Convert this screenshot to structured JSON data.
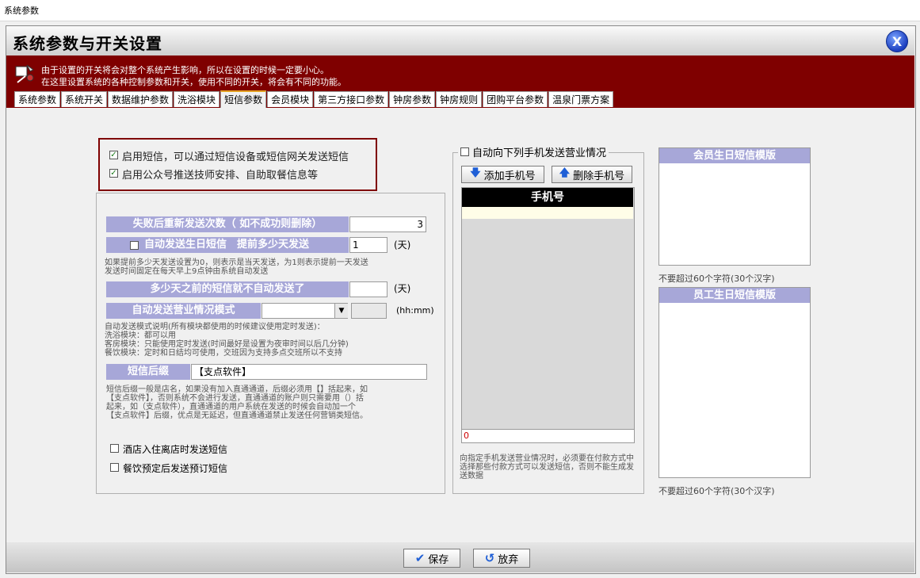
{
  "window": {
    "title": "系统参数"
  },
  "header": {
    "title": "系统参数与开关设置",
    "close_label": "X"
  },
  "banner": {
    "line1": "由于设置的开关将会对整个系统产生影响，所以在设置的时候一定要小心。",
    "line2": "在这里设置系统的各种控制参数和开关，使用不同的开关，将会有不同的功能。"
  },
  "tabs": [
    {
      "label": "系统参数"
    },
    {
      "label": "系统开关"
    },
    {
      "label": "数据维护参数"
    },
    {
      "label": "洗浴模块"
    },
    {
      "label": "短信参数"
    },
    {
      "label": "会员模块"
    },
    {
      "label": "第三方接口参数"
    },
    {
      "label": "钟房参数"
    },
    {
      "label": "钟房规则"
    },
    {
      "label": "团购平台参数"
    },
    {
      "label": "温泉门票方案"
    }
  ],
  "sms": {
    "enable_sms": {
      "label": "启用短信，可以通过短信设备或短信网关发送短信",
      "checked": true
    },
    "enable_wechat": {
      "label": "启用公众号推送技师安排、自助取餐信息等",
      "checked": true
    },
    "retry_label": "失败后重新发送次数（ 如不成功则删除）",
    "retry_value": "3",
    "birthday_label": "自动发送生日短信　提前多少天发送",
    "birthday_checked": false,
    "birthday_value": "1",
    "day_unit": "(天)",
    "birthday_note": "如果提前多少天发送设置为0，则表示是当天发送，为1则表示提前一天发送\n发送时间固定在每天早上9点钟由系统自动发送",
    "skip_label": "多少天之前的短信就不自动发送了",
    "skip_value": "",
    "mode_label": "自动发送营业情况模式",
    "mode_value": "",
    "time_value": "",
    "time_unit": "(hh:mm)",
    "mode_note": "自动发送模式说明(所有模块都使用的时候建议使用定时发送)：\n洗浴模块：都可以用\n客房模块：只能使用定时发送(时间最好是设置为夜审时间以后几分钟)\n餐饮模块：定时和日结均可使用，交班因为支持多点交班所以不支持",
    "suffix_label": "短信后缀",
    "suffix_value": "【支点软件】",
    "suffix_note": "短信后缀一般是店名，如果没有加入直通通道，后缀必须用【】括起来，如\n【支点软件】，否则系统不会进行发送，直通通道的账户则只需要用（）括\n起来，如（支点软件），直通通道的用户系统在发送的时候会自动加一个\n【支点软件】后缀，优点是无延迟，但直通通道禁止发送任何营销类短信。",
    "hotel_label": "酒店入住离店时发送短信",
    "hotel_checked": false,
    "dining_label": "餐饮预定后发送预订短信",
    "dining_checked": false
  },
  "phones": {
    "group_label": "自动向下列手机发送营业情况",
    "group_checked": false,
    "add_label": "添加手机号",
    "delete_label": "删除手机号",
    "column": "手机号",
    "count": "0",
    "note": "向指定手机发送营业情况时，必须要在付款方式中选择那些付款方式可以发送短信，否则不能生成发送数据"
  },
  "templates": {
    "member_title": "会员生日短信模版",
    "member_note": "不要超过60个字符(30个汉字)",
    "staff_title": "员工生日短信模版",
    "staff_note": "不要超过60个字符(30个汉字)"
  },
  "footer": {
    "save_label": "保存",
    "cancel_label": "放弃"
  },
  "colors": {
    "banner": "#7f0000",
    "label_bg": "#a7a7d8",
    "accent": "#e4a020"
  }
}
